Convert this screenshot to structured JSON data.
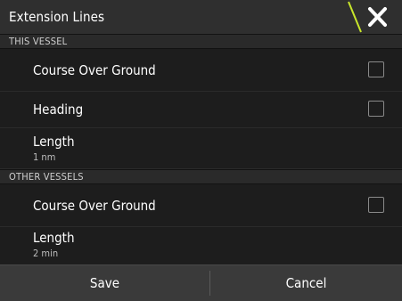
{
  "dialog": {
    "title": "Extension Lines",
    "close_icon": "close-icon",
    "accent_color": "#c8e62b"
  },
  "this_vessel": {
    "header": "THIS VESSEL",
    "course_over_ground": {
      "label": "Course Over Ground",
      "checked": false
    },
    "heading": {
      "label": "Heading",
      "checked": false
    },
    "length": {
      "label": "Length",
      "value": "1 nm"
    }
  },
  "other_vessels": {
    "header": "OTHER VESSELS",
    "course_over_ground": {
      "label": "Course Over Ground",
      "checked": false
    },
    "length": {
      "label": "Length",
      "value": "2 min"
    }
  },
  "footer": {
    "save_label": "Save",
    "cancel_label": "Cancel"
  }
}
